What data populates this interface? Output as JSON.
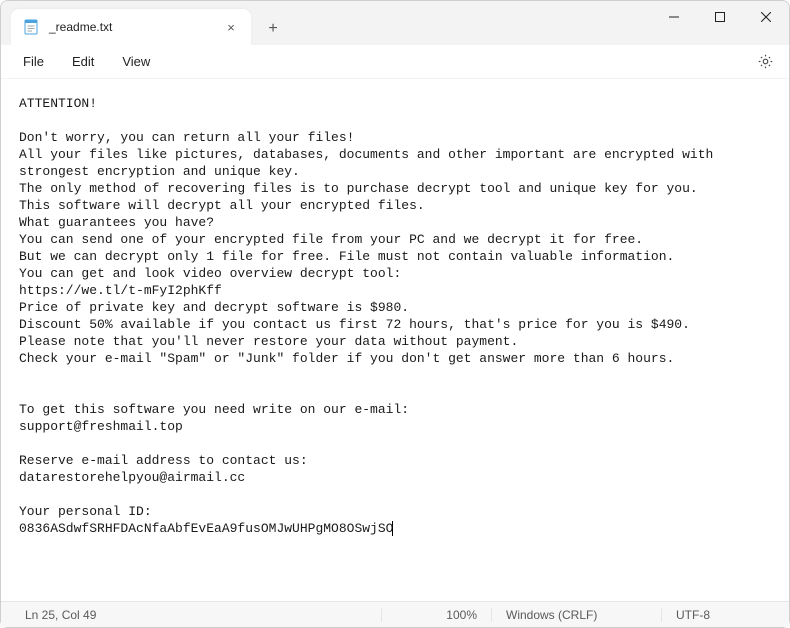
{
  "window": {
    "tab_title": "_readme.txt",
    "icons": {
      "app": "notepad-icon",
      "close_tab": "×",
      "new_tab": "+"
    }
  },
  "menu": {
    "file": "File",
    "edit": "Edit",
    "view": "View"
  },
  "content": {
    "lines": [
      "ATTENTION!",
      "",
      "Don't worry, you can return all your files!",
      "All your files like pictures, databases, documents and other important are encrypted with strongest encryption and unique key.",
      "The only method of recovering files is to purchase decrypt tool and unique key for you.",
      "This software will decrypt all your encrypted files.",
      "What guarantees you have?",
      "You can send one of your encrypted file from your PC and we decrypt it for free.",
      "But we can decrypt only 1 file for free. File must not contain valuable information.",
      "You can get and look video overview decrypt tool:",
      "https://we.tl/t-mFyI2phKff",
      "Price of private key and decrypt software is $980.",
      "Discount 50% available if you contact us first 72 hours, that's price for you is $490.",
      "Please note that you'll never restore your data without payment.",
      "Check your e-mail \"Spam\" or \"Junk\" folder if you don't get answer more than 6 hours.",
      "",
      "",
      "To get this software you need write on our e-mail:",
      "support@freshmail.top",
      "",
      "Reserve e-mail address to contact us:",
      "datarestorehelpyou@airmail.cc",
      "",
      "Your personal ID:",
      "0836ASdwfSRHFDAcNfaAbfEvEaA9fusOMJwUHPgMO8OSwjSO"
    ]
  },
  "status": {
    "position": "Ln 25, Col 49",
    "zoom": "100%",
    "eol": "Windows (CRLF)",
    "encoding": "UTF-8"
  }
}
